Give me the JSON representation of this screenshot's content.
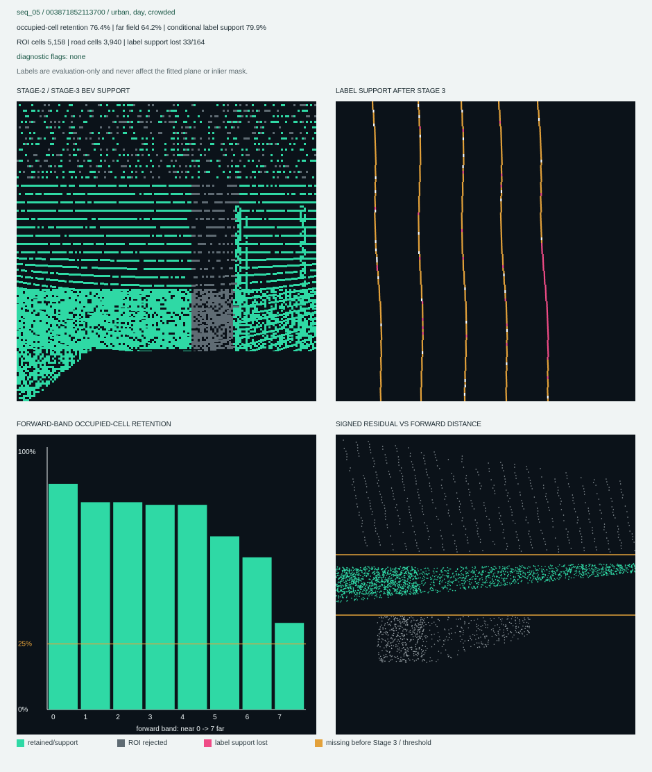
{
  "header": {
    "sequence": "seq_05 / 003871852113700 / urban, day, crowded",
    "retention": "occupied-cell retention 76.4% | far field 64.2% | conditional label support 79.9%",
    "counts": "ROI cells 5,158 | road cells 3,940 | label support lost 33/164",
    "flags": "diagnostic flags: none",
    "note": "Labels are evaluation-only and never affect the fitted plane or inlier mask."
  },
  "panels": {
    "bev": {
      "title": "STAGE-2 / STAGE-3 BEV SUPPORT"
    },
    "labels": {
      "title": "LABEL SUPPORT AFTER STAGE 3"
    },
    "retention": {
      "title": "FORWARD-BAND OCCUPIED-CELL RETENTION"
    },
    "residual": {
      "title": "SIGNED RESIDUAL VS FORWARD DISTANCE"
    }
  },
  "chart_data": {
    "type": "bar",
    "title": "FORWARD-BAND OCCUPIED-CELL RETENTION",
    "categories": [
      "0",
      "1",
      "2",
      "3",
      "4",
      "5",
      "6",
      "7"
    ],
    "values": [
      86,
      79,
      79,
      78,
      78,
      66,
      58,
      33
    ],
    "unit": "%",
    "ylim": [
      0,
      100
    ],
    "yticks": [
      "100%",
      "25%",
      "0%"
    ],
    "reference_line": {
      "value": 25,
      "label": "25%",
      "color": "#e3a13a"
    },
    "xlabel": "forward band: near 0 -> 7 far",
    "bar_color": "#2fd9a5"
  },
  "legend": [
    {
      "label": "retained/support",
      "color": "#2fd9a5"
    },
    {
      "label": "ROI rejected",
      "color": "#5f6b73"
    },
    {
      "label": "label support lost",
      "color": "#ef4b86"
    },
    {
      "label": "missing before Stage 3 / threshold",
      "color": "#e3a13a"
    }
  ],
  "colors": {
    "panel_bg": "#0b1219",
    "retained": "#2fd9a5",
    "rejected": "#5f6b73",
    "lost": "#ef4b86",
    "missing": "#e3a13a"
  }
}
